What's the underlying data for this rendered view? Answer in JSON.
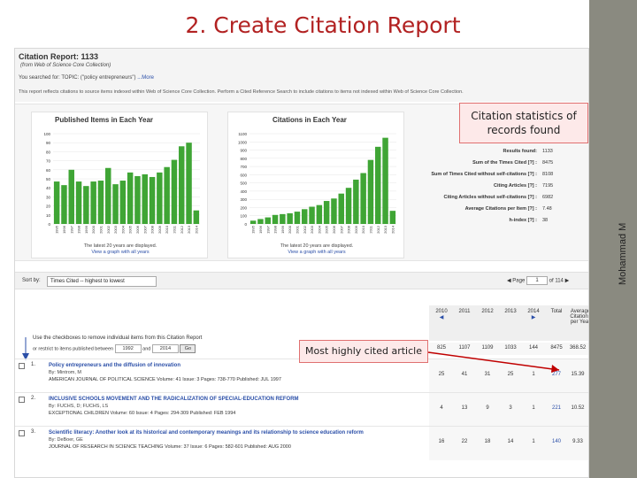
{
  "slide": {
    "title": "2. Create Citation Report",
    "author": "Mohammad M"
  },
  "report": {
    "title": "Citation Report: 1133",
    "source": "(from Web of Science Core Collection)",
    "search_prefix": "You searched for:",
    "search_topic": "TOPIC: (\"policy entrepreneurs\")",
    "search_more": "...More",
    "note": "This report reflects citations to source items indexed within Web of Science Core Collection. Perform a Cited Reference Search to include citations to items not indexed within Web of Science Core Collection."
  },
  "charts": {
    "published": {
      "title": "Published Items in Each Year",
      "caption": "The latest 20 years are displayed.",
      "link": "View a graph with all years"
    },
    "citations": {
      "title": "Citations in Each Year",
      "caption": "The latest 20 years are displayed.",
      "link": "View a graph with all years"
    }
  },
  "chart_data": [
    {
      "type": "bar",
      "title": "Published Items in Each Year",
      "categories": [
        "1995",
        "1996",
        "1997",
        "1998",
        "1999",
        "2000",
        "2001",
        "2002",
        "2003",
        "2004",
        "2005",
        "2006",
        "2007",
        "2008",
        "2009",
        "2010",
        "2011",
        "2012",
        "2013",
        "2014"
      ],
      "values": [
        47,
        43,
        60,
        47,
        42,
        47,
        48,
        62,
        44,
        48,
        57,
        53,
        55,
        52,
        57,
        63,
        71,
        86,
        90,
        15
      ],
      "ylim": [
        0,
        100
      ],
      "yticks": [
        0,
        10,
        20,
        30,
        40,
        50,
        60,
        70,
        80,
        90,
        100
      ]
    },
    {
      "type": "bar",
      "title": "Citations in Each Year",
      "categories": [
        "1995",
        "1996",
        "1997",
        "1998",
        "1999",
        "2000",
        "2001",
        "2002",
        "2003",
        "2004",
        "2005",
        "2006",
        "2007",
        "2008",
        "2009",
        "2010",
        "2011",
        "2012",
        "2013",
        "2014"
      ],
      "values": [
        40,
        60,
        80,
        110,
        120,
        130,
        150,
        180,
        210,
        230,
        280,
        310,
        370,
        440,
        540,
        620,
        780,
        940,
        1050,
        160
      ],
      "ylim": [
        0,
        1100
      ],
      "yticks": [
        0,
        100,
        200,
        300,
        400,
        500,
        600,
        700,
        800,
        900,
        1000,
        1100
      ]
    }
  ],
  "stats": [
    {
      "label": "Results found:",
      "value": "1133"
    },
    {
      "label": "Sum of the Times Cited [?] :",
      "value": "8475"
    },
    {
      "label": "Sum of Times Cited without self-citations [?] :",
      "value": "8108"
    },
    {
      "label": "Citing Articles [?] :",
      "value": "7195"
    },
    {
      "label": "Citing Articles without self-citations [?] :",
      "value": "6982"
    },
    {
      "label": "Average Citations per Item [?] :",
      "value": "7.48"
    },
    {
      "label": "h-index [?] :",
      "value": "38"
    }
  ],
  "callouts": {
    "stats": "Citation statistics of records found",
    "highly_cited": "Most highly cited article"
  },
  "sort": {
    "label": "Sort by:",
    "value": "Times Cited -- highest to lowest",
    "page_label": "Page",
    "page_value": "1",
    "page_of": "of 114"
  },
  "table": {
    "remove_text": "Use the checkboxes to remove individual items from this Citation Report",
    "range_text": "or restrict to items published between",
    "range_from": "1992",
    "range_and": "and",
    "range_to": "2014",
    "go": "Go",
    "headers": [
      "2010",
      "2011",
      "2012",
      "2013",
      "2014",
      "Total",
      "Average Citations per Year"
    ],
    "header_top_values": [
      "825",
      "1107",
      "1109",
      "1033",
      "144",
      "8475",
      "368.52"
    ],
    "records": [
      {
        "num": "1.",
        "title": "Policy entrepreneurs and the diffusion of innovation",
        "by": "By: Mintrom, M",
        "journal": "AMERICAN JOURNAL OF POLITICAL SCIENCE  Volume: 41  Issue: 3  Pages: 738-770  Published: JUL 1997",
        "cells": [
          "25",
          "41",
          "31",
          "25",
          "1",
          "277",
          "15.39"
        ]
      },
      {
        "num": "2.",
        "title": "INCLUSIVE SCHOOLS MOVEMENT AND THE RADICALIZATION OF SPECIAL-EDUCATION REFORM",
        "by": "By: FUCHS, D; FUCHS, LS",
        "journal": "EXCEPTIONAL CHILDREN  Volume: 60  Issue: 4  Pages: 294-309  Published: FEB 1994",
        "cells": [
          "4",
          "13",
          "9",
          "3",
          "1",
          "221",
          "10.52"
        ]
      },
      {
        "num": "3.",
        "title": "Scientific literacy: Another look at its historical and contemporary meanings and its relationship to science education reform",
        "by": "By: DeBoer, GE",
        "journal": "JOURNAL OF RESEARCH IN SCIENCE TEACHING  Volume: 37  Issue: 6  Pages: 582-601  Published: AUG 2000",
        "cells": [
          "16",
          "22",
          "18",
          "14",
          "1",
          "140",
          "9.33"
        ]
      }
    ]
  },
  "colors": {
    "bar": "#3fa535",
    "title": "#b22222",
    "link": "#2b4fa8",
    "callout_border": "#e07070"
  }
}
